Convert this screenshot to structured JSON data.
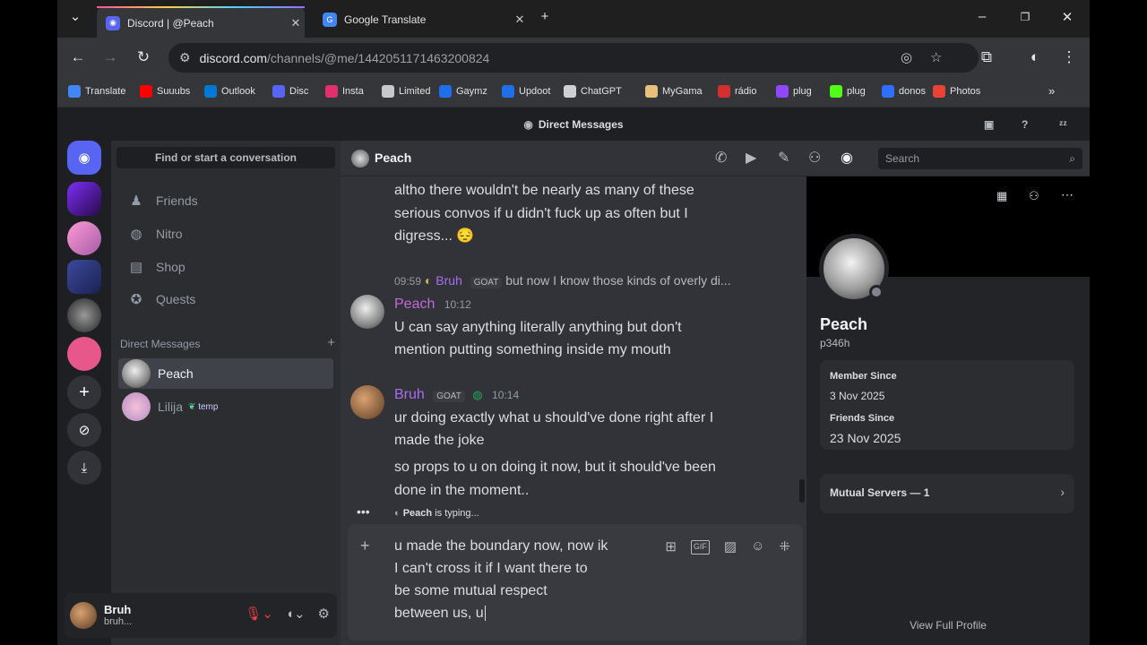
{
  "browser": {
    "tabs": [
      {
        "title": "Discord | @Peach",
        "active": true
      },
      {
        "title": "Google Translate",
        "active": false
      }
    ],
    "url_host": "discord.com",
    "url_path": "/channels/@me/1442051171463200824",
    "bookmarks": [
      "Translate",
      "Suuubs",
      "Outlook",
      "Disc",
      "Insta",
      "Limited",
      "Gaymz",
      "Updoot",
      "ChatGPT",
      "MyGama",
      "rádio",
      "plug",
      "plug",
      "donos",
      "Photos"
    ]
  },
  "app": {
    "title": "Direct Messages"
  },
  "sidebar": {
    "search_label": "Find or start a conversation",
    "nav": [
      {
        "label": "Friends",
        "icon": "friends-icon"
      },
      {
        "label": "Nitro",
        "icon": "nitro-icon"
      },
      {
        "label": "Shop",
        "icon": "shop-icon"
      },
      {
        "label": "Quests",
        "icon": "quests-icon"
      }
    ],
    "dm_header": "Direct Messages",
    "dms": [
      {
        "name": "Peach",
        "active": true
      },
      {
        "name": "Lilija",
        "badge": "temp"
      }
    ]
  },
  "user_panel": {
    "name": "Bruh",
    "status": "bruh..."
  },
  "chat": {
    "recipient": "Peach",
    "search_placeholder": "Search",
    "msg0_lines": [
      "altho there wouldn't be nearly as many of these",
      "serious convos if u didn't fuck up as often but I",
      "digress... 😔"
    ],
    "reply": {
      "time": "09:59",
      "author": "Bruh",
      "badge": "GOAT",
      "text": "but now I know those kinds of overly di..."
    },
    "msg1": {
      "author": "Peach",
      "time": "10:12",
      "lines": [
        "U can say anything literally anything but don't",
        "mention putting something inside my mouth"
      ]
    },
    "msg2": {
      "author": "Bruh",
      "badge": "GOAT",
      "time": "10:14",
      "lines": [
        "ur doing exactly what u should've done right after I",
        "made the joke"
      ],
      "lines2": [
        "so props to u on doing it now, but it should've been",
        "done in the moment.."
      ]
    },
    "typing_name": "Peach",
    "typing_suffix": "is typing...",
    "composer_lines": [
      "u made the boundary now, now ik",
      "I can't cross it if I want there to",
      "be some mutual respect",
      "between us, u"
    ]
  },
  "profile": {
    "name": "Peach",
    "tag": "p346h",
    "member_since_label": "Member Since",
    "member_since": "3 Nov 2025",
    "friends_since_label": "Friends Since",
    "friends_since": "23 Nov 2025",
    "mutual_servers": "Mutual Servers — 1",
    "view_full": "View Full Profile"
  },
  "colors": {
    "accent": "#5865f2",
    "peach_name": "#c06ad9",
    "bruh_name": "#a56ff0",
    "online": "#23a55a"
  }
}
